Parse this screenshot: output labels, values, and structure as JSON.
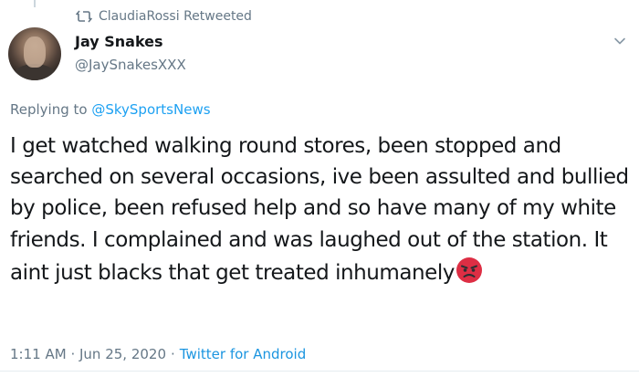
{
  "retweet": {
    "icon": "retweet-icon",
    "label": "ClaudiaRossi Retweeted"
  },
  "author": {
    "display_name": "Jay Snakes",
    "handle": "@JaySnakesXXX",
    "avatar_icon": "user-avatar"
  },
  "menu": {
    "icon": "chevron-down-icon"
  },
  "reply": {
    "prefix": "Replying to",
    "target": "@SkySportsNews"
  },
  "tweet": {
    "text": "I get watched walking round stores, been stopped and searched on several occasions, ive been assulted and bullied by police, been refused help and so have many of my white friends. I complained and was laughed out of the station. It aint just blacks that get treated inhumanely",
    "emoji": "angry-face-emoji"
  },
  "meta": {
    "time": "1:11 AM",
    "separator1": "·",
    "date": "Jun 25, 2020",
    "separator2": "·",
    "source": "Twitter for Android"
  },
  "colors": {
    "link": "#1da1f2",
    "muted": "#657786",
    "text": "#14171a"
  }
}
